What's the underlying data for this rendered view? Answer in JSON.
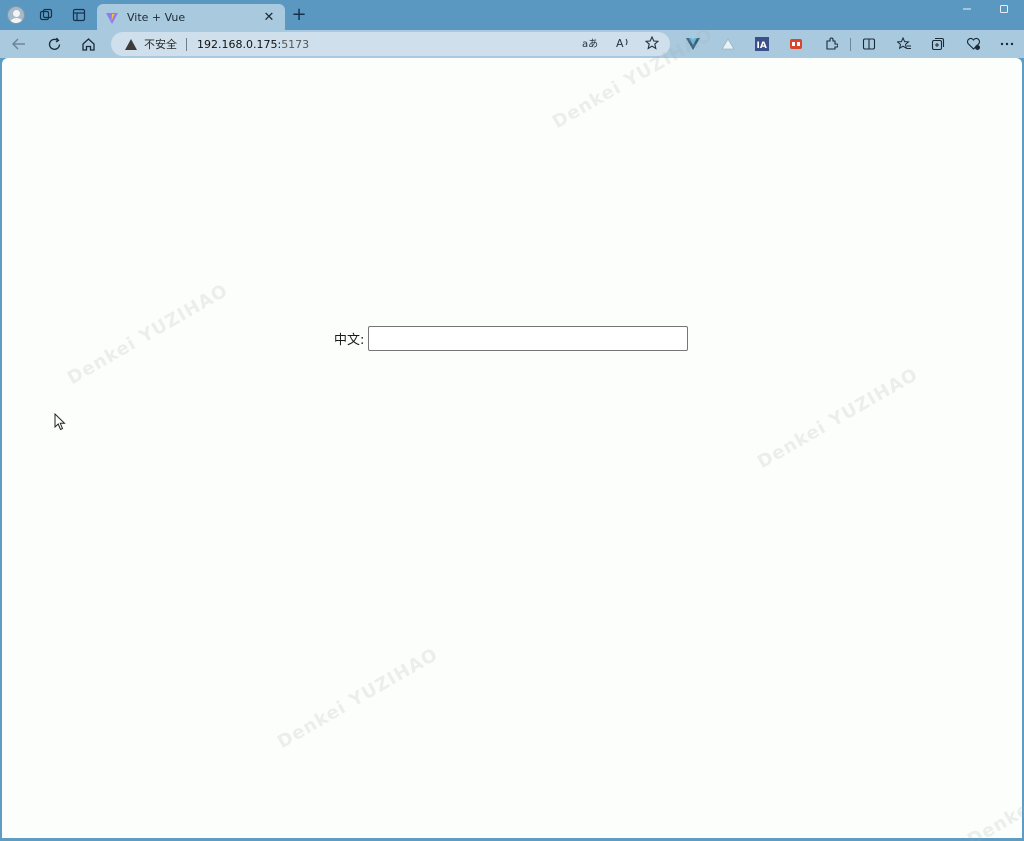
{
  "tab": {
    "title": "Vite + Vue",
    "close": "✕"
  },
  "new_tab": "+",
  "address": {
    "insecure_label": "不安全",
    "url_host": "192.168.0.175:",
    "url_port": "5173"
  },
  "form": {
    "label": "中文:",
    "input_value": ""
  },
  "watermark_text": "Denkei YUZIHAO",
  "colors": {
    "tabbar": "#5b98c1",
    "toolbar": "#a9c9df",
    "page": "#fcfefc"
  }
}
